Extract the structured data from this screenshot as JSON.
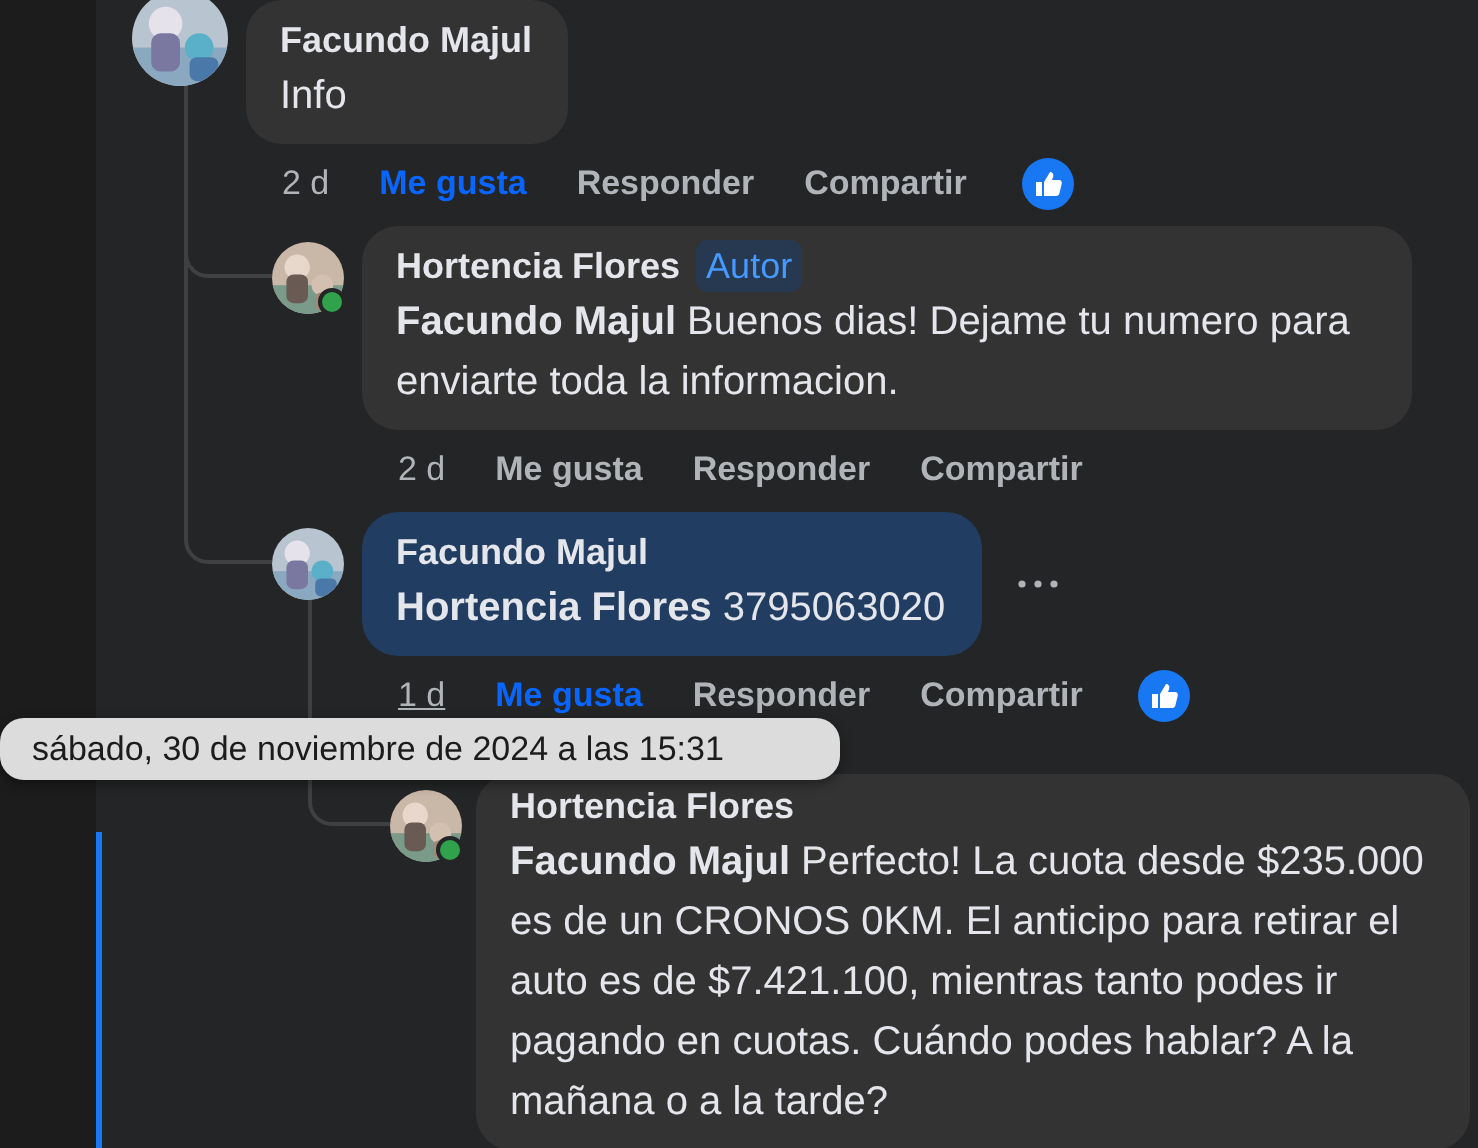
{
  "comments": [
    {
      "author": "Facundo Majul",
      "online": false,
      "text": "Info",
      "highlighted": false,
      "time": "2 d",
      "time_underlined": false,
      "like_label": "Me gusta",
      "liked": true,
      "reply_label": "Responder",
      "share_label": "Compartir",
      "reaction": true,
      "more_button": false,
      "children": [
        {
          "author": "Hortencia Flores",
          "online": true,
          "badge": "Autor",
          "text": "**Facundo Majul** Buenos dias! Dejame tu numero para enviarte toda la informacion.",
          "highlighted": false,
          "time": "2 d",
          "time_underlined": false,
          "like_label": "Me gusta",
          "liked": false,
          "reply_label": "Responder",
          "share_label": "Compartir",
          "reaction": false,
          "more_button": false
        },
        {
          "author": "Facundo Majul",
          "online": false,
          "text": "**Hortencia Flores** 3795063020",
          "highlighted": true,
          "time": "1 d",
          "time_underlined": true,
          "like_label": "Me gusta",
          "liked": true,
          "reply_label": "Responder",
          "share_label": "Compartir",
          "reaction": true,
          "more_button": true,
          "children": [
            {
              "author": "Hortencia Flores",
              "online": true,
              "text": "**Facundo Majul** Perfecto! La cuota desde $235.000 es de un CRONOS 0KM. El anticipo para retirar el auto es de $7.421.100, mientras tanto podes ir pagando en cuotas. Cuándo podes hablar? A la mañana o a la tarde?",
              "highlighted": false,
              "more_button": false
            }
          ]
        }
      ]
    }
  ],
  "tooltip": {
    "text": "sábado, 30 de noviembre de 2024 a las 15:31"
  }
}
